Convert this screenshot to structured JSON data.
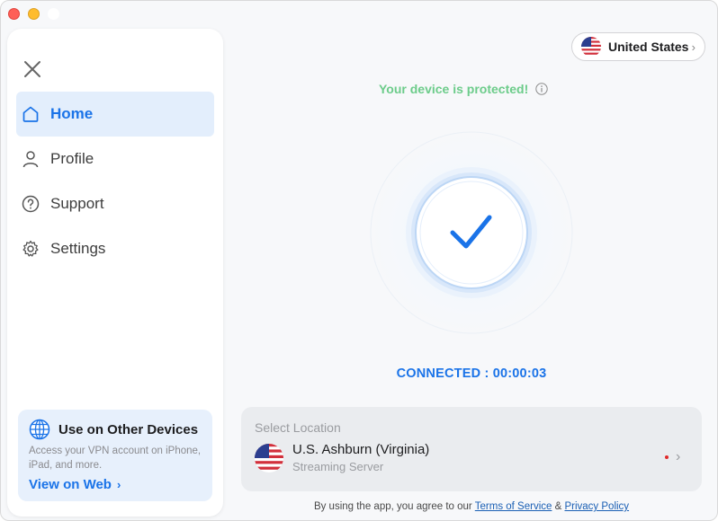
{
  "sidebar": {
    "items": [
      {
        "label": "Home",
        "icon": "home-icon",
        "active": true
      },
      {
        "label": "Profile",
        "icon": "person-icon",
        "active": false
      },
      {
        "label": "Support",
        "icon": "question-icon",
        "active": false
      },
      {
        "label": "Settings",
        "icon": "gear-icon",
        "active": false
      }
    ],
    "devices_card": {
      "title": "Use on Other Devices",
      "description": "Access your VPN account on iPhone, iPad, and more.",
      "link": "View on Web"
    }
  },
  "header": {
    "country": "United States"
  },
  "status": {
    "message": "Your device is protected!",
    "connection": "CONNECTED : 00:00:03"
  },
  "location": {
    "heading": "Select Location",
    "name": "U.S. Ashburn (Virginia)",
    "type": "Streaming Server"
  },
  "footer": {
    "prefix": "By using the app, you agree to our",
    "terms": "Terms of Service",
    "amp": "&",
    "privacy": "Privacy Policy"
  },
  "colors": {
    "accent": "#1a73e8",
    "protected_green": "#6ccc8a",
    "active_nav_bg": "#e3eefc"
  }
}
